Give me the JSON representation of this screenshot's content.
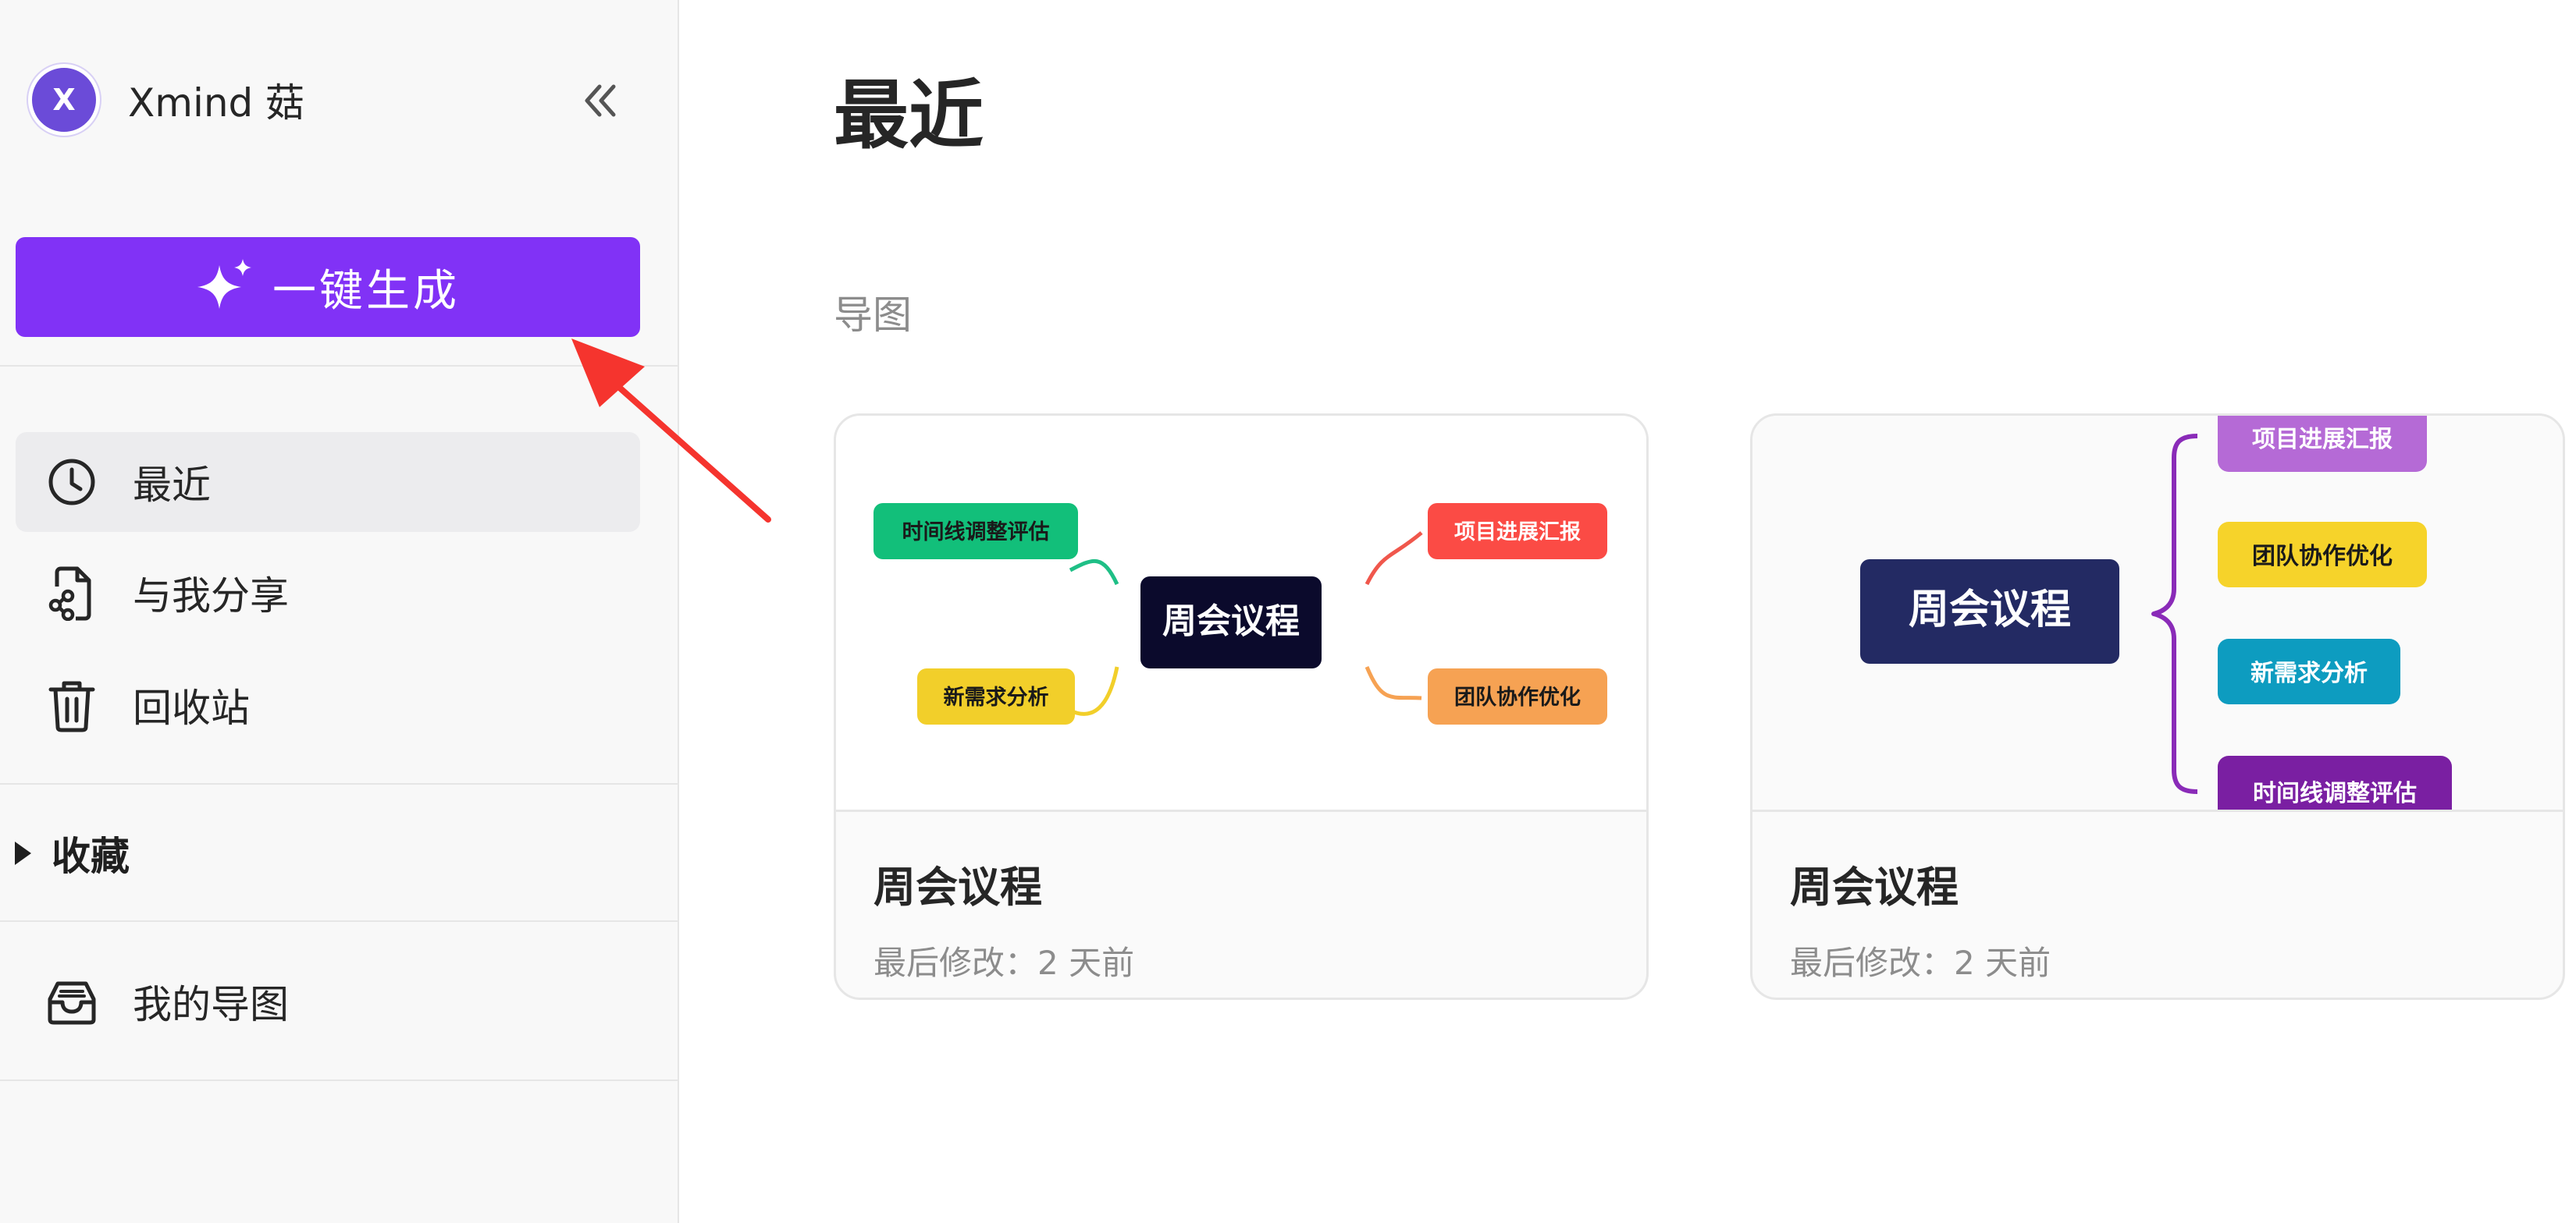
{
  "sidebar": {
    "account": {
      "initial": "X",
      "name": "Xmind 菇",
      "avatar_color": "#6b4bd8"
    },
    "generate_button": {
      "label": "一键生成",
      "color": "#8132f6"
    },
    "nav": [
      {
        "label": "最近",
        "icon": "clock-icon",
        "active": true
      },
      {
        "label": "与我分享",
        "icon": "shared-file-icon",
        "active": false
      },
      {
        "label": "回收站",
        "icon": "trash-icon",
        "active": false
      }
    ],
    "favorites": {
      "label": "收藏",
      "icon": "caret-right-icon"
    },
    "my_maps": {
      "label": "我的导图",
      "icon": "inbox-icon"
    }
  },
  "main": {
    "title": "最近",
    "section": "导图",
    "cards": [
      {
        "title": "周会议程",
        "meta": "最后修改：2 天前",
        "thumbnail": {
          "center": "周会议程",
          "topics": [
            "时间线调整评估",
            "新需求分析",
            "项目进展汇报",
            "团队协作优化"
          ]
        }
      },
      {
        "title": "周会议程",
        "meta": "最后修改：2 天前",
        "thumbnail": {
          "center": "周会议程",
          "topics": [
            "项目进展汇报",
            "团队协作优化",
            "新需求分析",
            "时间线调整评估"
          ]
        }
      }
    ]
  },
  "colors": {
    "accent": "#8132f6",
    "callout_arrow": "#f5342e",
    "topic_green": "#12bf7a",
    "topic_yellow": "#f2cf2a",
    "topic_red": "#fb4b45",
    "topic_orange": "#f6a253",
    "center_dark": "#0b0a2c",
    "center_navy": "#232a63",
    "topic_purple_light": "#b56ad6",
    "topic_cyan": "#0d9cc0",
    "topic_purple_dark": "#7a1fa2",
    "bracket": "#8a2bb8"
  }
}
